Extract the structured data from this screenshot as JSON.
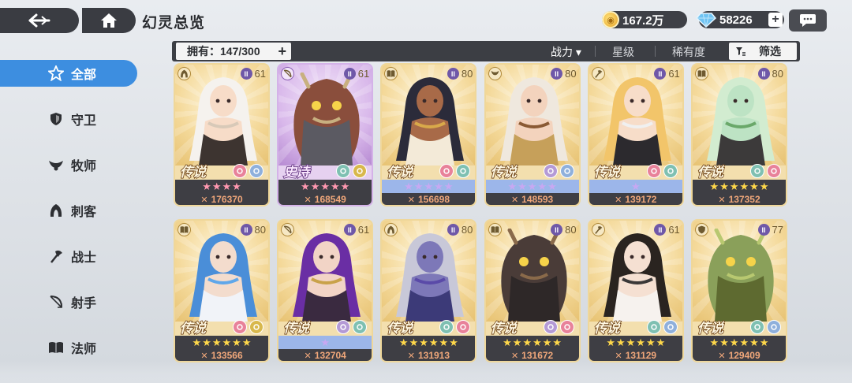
{
  "header": {
    "title": "幻灵总览",
    "gold": "167.2万",
    "gems": "58226",
    "plus": "+"
  },
  "toolbar": {
    "owned_label": "拥有：147/300",
    "plus": "+",
    "sort_power": "战力 ▾",
    "sort_star": "星级",
    "sort_rarity": "稀有度",
    "filter": "筛选"
  },
  "sidebar": {
    "items": [
      {
        "label": "全部",
        "icon": "star-outline-icon"
      },
      {
        "label": "守卫",
        "icon": "shield-icon"
      },
      {
        "label": "牧师",
        "icon": "wings-icon"
      },
      {
        "label": "刺客",
        "icon": "hood-icon"
      },
      {
        "label": "战士",
        "icon": "axe-icon"
      },
      {
        "label": "射手",
        "icon": "bow-icon"
      },
      {
        "label": "法师",
        "icon": "book-icon"
      }
    ]
  },
  "colors": {
    "accent": "#3d8ee0",
    "dark": "#3c3e44",
    "legend_border": "#efd79a",
    "epic_border": "#d4b2e8"
  },
  "cards": [
    {
      "rarity": "传说",
      "level": "61",
      "power": "176370",
      "stars": 4,
      "star_style": "pink",
      "class_icon": "hood-icon",
      "elements": [
        "#e8829a",
        "#8fb0dc"
      ],
      "epic": false
    },
    {
      "rarity": "史诗",
      "level": "61",
      "power": "168549",
      "stars": 5,
      "star_style": "pink",
      "class_icon": "bow-icon",
      "elements": [
        "#7fc0b2",
        "#d8b84c"
      ],
      "epic": true
    },
    {
      "rarity": "传说",
      "level": "80",
      "power": "156698",
      "stars": 5,
      "star_style": "blue",
      "class_icon": "book-icon",
      "elements": [
        "#e8829a",
        "#7fc0b2"
      ],
      "epic": false
    },
    {
      "rarity": "传说",
      "level": "80",
      "power": "148593",
      "stars": 5,
      "star_style": "blue",
      "class_icon": "wings-icon",
      "elements": [
        "#b49ad6",
        "#8fb0dc"
      ],
      "epic": false
    },
    {
      "rarity": "传说",
      "level": "61",
      "power": "139172",
      "stars": 1,
      "star_style": "blue",
      "class_icon": "axe-icon",
      "elements": [
        "#e8829a",
        "#7fc0b2"
      ],
      "epic": false
    },
    {
      "rarity": "传说",
      "level": "80",
      "power": "137352",
      "stars": 6,
      "star_style": "gold",
      "class_icon": "book-icon",
      "elements": [
        "#7fc0b2",
        "#e8829a"
      ],
      "epic": false
    },
    {
      "rarity": "传说",
      "level": "80",
      "power": "133566",
      "stars": 6,
      "star_style": "gold",
      "class_icon": "book-icon",
      "elements": [
        "#e8829a",
        "#d8b84c"
      ],
      "epic": false
    },
    {
      "rarity": "传说",
      "level": "61",
      "power": "132704",
      "stars": 1,
      "star_style": "blue",
      "class_icon": "bow-icon",
      "elements": [
        "#b49ad6",
        "#7fc0b2"
      ],
      "epic": false
    },
    {
      "rarity": "传说",
      "level": "80",
      "power": "131913",
      "stars": 6,
      "star_style": "gold",
      "class_icon": "hood-icon",
      "elements": [
        "#7fc0b2",
        "#e8829a"
      ],
      "epic": false
    },
    {
      "rarity": "传说",
      "level": "80",
      "power": "131672",
      "stars": 6,
      "star_style": "gold",
      "class_icon": "book-icon",
      "elements": [
        "#b49ad6",
        "#e8829a"
      ],
      "epic": false
    },
    {
      "rarity": "传说",
      "level": "61",
      "power": "131129",
      "stars": 6,
      "star_style": "gold",
      "class_icon": "axe-icon",
      "elements": [
        "#7fc0b2",
        "#8fb0dc"
      ],
      "epic": false
    },
    {
      "rarity": "传说",
      "level": "77",
      "power": "129409",
      "stars": 6,
      "star_style": "gold",
      "class_icon": "shield-icon",
      "elements": [
        "#7fc0b2",
        "#8fb0dc"
      ],
      "epic": false
    }
  ]
}
